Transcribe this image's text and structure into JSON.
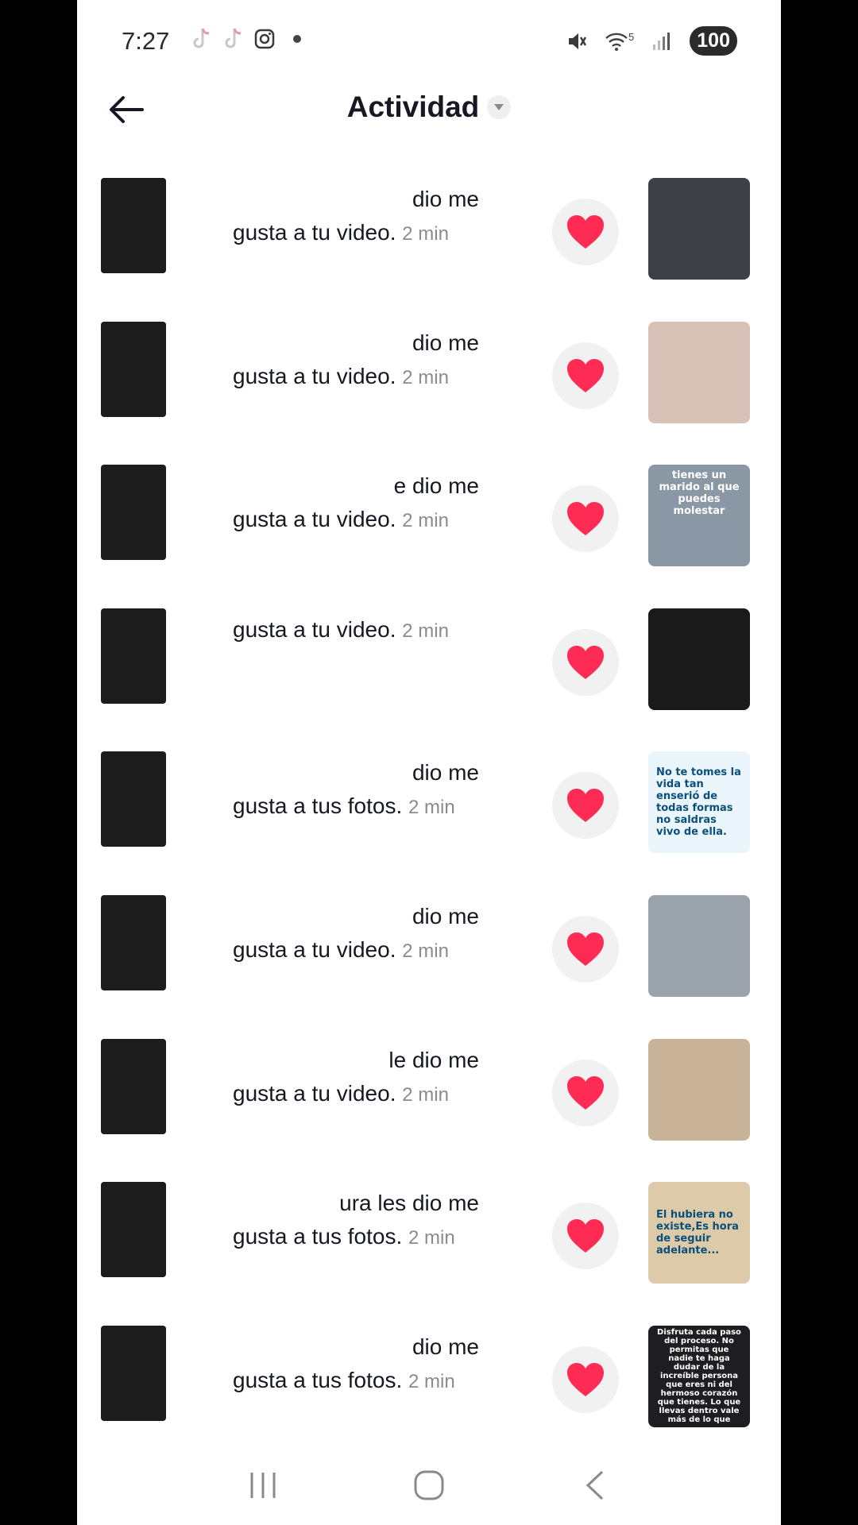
{
  "status_bar": {
    "time": "7:27",
    "battery": "100",
    "left_icons": [
      "tiktok-icon",
      "tiktok-icon",
      "instagram-icon",
      "dot"
    ],
    "right_icons": [
      "mute-icon",
      "wifi-icon",
      "signal-icon"
    ],
    "wifi_label": "5"
  },
  "header": {
    "title": "Actividad",
    "back_icon": "arrow-left-icon",
    "dropdown_icon": "caret-down-icon"
  },
  "colors": {
    "heart": "#fe2c55",
    "like_bubble_bg": "#f1f1f2",
    "time_text": "#8a8b91"
  },
  "activities": [
    {
      "line1": "dio me",
      "line2": "gusta a tu video.",
      "time": "2 min",
      "thumb_color": "#3d4046",
      "thumb_text": ""
    },
    {
      "line1": "dio me",
      "line2": "gusta a tu video.",
      "time": "2 min",
      "thumb_color": "#d8c2b7",
      "thumb_text": ""
    },
    {
      "line1": "e dio me",
      "line2": "gusta a tu video.",
      "time": "2 min",
      "thumb_color": "#8a98a6",
      "thumb_text": "tienes un marido al que puedes molestar"
    },
    {
      "line1": "",
      "line2": "gusta a tu video.",
      "time": "2 min",
      "thumb_color": "#1a1a1a",
      "thumb_text": ""
    },
    {
      "line1": "dio me",
      "line2": "gusta a tus fotos.",
      "time": "2 min",
      "thumb_color": "#eaf6fb",
      "thumb_text": "No te tomes la vida tan enserió de todas formas no saldras vivo de ella."
    },
    {
      "line1": "dio me",
      "line2": "gusta a tu video.",
      "time": "2 min",
      "thumb_color": "#9aa3ab",
      "thumb_text": ""
    },
    {
      "line1": "le dio me",
      "line2": "gusta a tu video.",
      "time": "2 min",
      "thumb_color": "#c9b49a",
      "thumb_text": ""
    },
    {
      "line1": "ura les dio me",
      "line2": "gusta a tus fotos.",
      "time": "2 min",
      "thumb_color": "#dccaa8",
      "thumb_text": "El hubiera no existe,Es hora de seguir adelante..."
    },
    {
      "line1": "dio me",
      "line2": "gusta a tus fotos.",
      "time": "2 min",
      "thumb_color": "#1d1d22",
      "thumb_text": "Disfruta cada paso del proceso. No permitas que nadie te haga dudar de la increíble persona que eres ni del hermoso corazón que tienes. Lo que llevas dentro vale más de lo que"
    }
  ],
  "nav": {
    "recents_icon": "recents-icon",
    "home_icon": "home-icon",
    "back_icon": "nav-back-icon"
  }
}
